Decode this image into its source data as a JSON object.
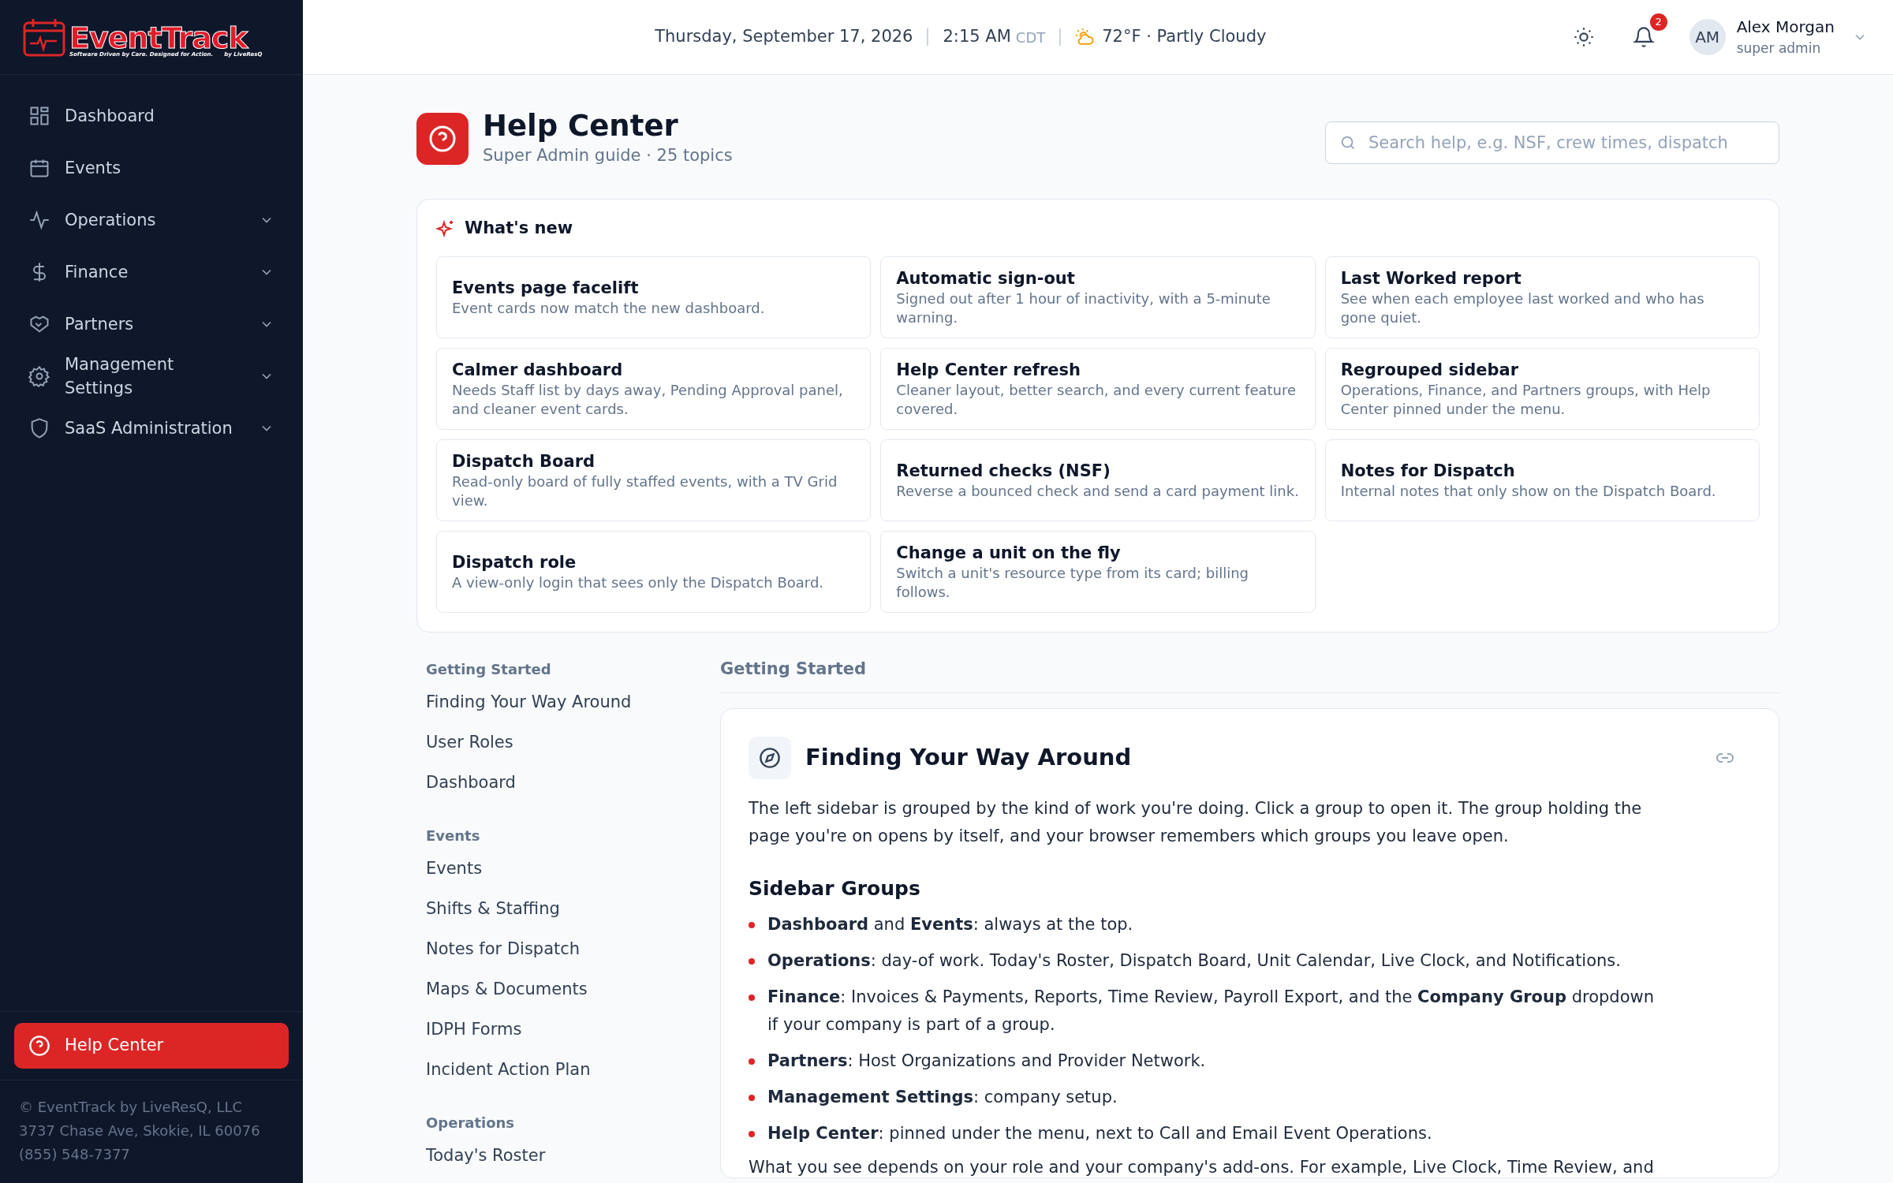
{
  "brand": {
    "name": "EventTrack",
    "tagline": "Software Driven by Care. Designed for Action.",
    "byline": "by LiveResQ"
  },
  "sidebar": {
    "items": [
      {
        "label": "Dashboard",
        "kind": "link"
      },
      {
        "label": "Events",
        "kind": "link"
      },
      {
        "label": "Operations",
        "kind": "group",
        "expanded": false
      },
      {
        "label": "Finance",
        "kind": "group",
        "expanded": false
      },
      {
        "label": "Partners",
        "kind": "group",
        "expanded": false
      },
      {
        "label": "Management Settings",
        "kind": "group",
        "expanded": false
      },
      {
        "label": "SaaS Administration",
        "kind": "group",
        "expanded": false
      }
    ],
    "help_button": "Help Center",
    "footer": [
      "© EventTrack by LiveResQ, LLC",
      "3737 Chase Ave, Skokie, IL 60076",
      "(855) 548-7377"
    ]
  },
  "header": {
    "date": "Thursday, September 17, 2026",
    "time": "2:15 AM",
    "timezone": "CDT",
    "weather": "72°F · Partly Cloudy",
    "notification_count": "2",
    "user": {
      "initials": "AM",
      "name": "Alex Morgan",
      "role": "super admin"
    }
  },
  "help": {
    "title": "Help Center",
    "subtitle": "Super Admin guide · 25 topics",
    "search_placeholder": "Search help, e.g. NSF, crew times, dispatch"
  },
  "whats_new": {
    "title": "What's new",
    "items": [
      {
        "title": "Events page facelift",
        "description": "Event cards now match the new dashboard."
      },
      {
        "title": "Automatic sign-out",
        "description": "Signed out after 1 hour of inactivity, with a 5-minute warning."
      },
      {
        "title": "Last Worked report",
        "description": "See when each employee last worked and who has gone quiet."
      },
      {
        "title": "Calmer dashboard",
        "description": "Needs Staff list by days away, Pending Approval panel, and cleaner event cards."
      },
      {
        "title": "Help Center refresh",
        "description": "Cleaner layout, better search, and every current feature covered."
      },
      {
        "title": "Regrouped sidebar",
        "description": "Operations, Finance, and Partners groups, with Help Center pinned under the menu."
      },
      {
        "title": "Dispatch Board",
        "description": "Read-only board of fully staffed events, with a TV Grid view."
      },
      {
        "title": "Returned checks (NSF)",
        "description": "Reverse a bounced check and send a card payment link."
      },
      {
        "title": "Notes for Dispatch",
        "description": "Internal notes that only show on the Dispatch Board."
      },
      {
        "title": "Dispatch role",
        "description": "A view-only login that sees only the Dispatch Board."
      },
      {
        "title": "Change a unit on the fly",
        "description": "Switch a unit's resource type from its card; billing follows."
      }
    ]
  },
  "toc": [
    {
      "heading": "Getting Started",
      "items": [
        "Finding Your Way Around",
        "User Roles",
        "Dashboard"
      ]
    },
    {
      "heading": "Events",
      "items": [
        "Events",
        "Shifts & Staffing",
        "Notes for Dispatch",
        "Maps & Documents",
        "IDPH Forms",
        "Incident Action Plan"
      ]
    },
    {
      "heading": "Operations",
      "items": [
        "Today's Roster"
      ]
    }
  ],
  "article": {
    "section": "Getting Started",
    "title": "Finding Your Way Around",
    "intro": "The left sidebar is grouped by the kind of work you're doing. Click a group to open it. The group holding the page you're on opens by itself, and your browser remembers which groups you leave open.",
    "subheading": "Sidebar Groups",
    "bullets": [
      "**Dashboard** and **Events**: always at the top.",
      "**Operations**: day-of work. Today's Roster, Dispatch Board, Unit Calendar, Live Clock, and Notifications.",
      "**Finance**: Invoices & Payments, Reports, Time Review, Payroll Export, and the **Company Group** dropdown if your company is part of a group.",
      "**Partners**: Host Organizations and Provider Network.",
      "**Management Settings**: company setup.",
      "**Help Center**: pinned under the menu, next to Call and Email Event Operations."
    ],
    "outro": "What you see depends on your role and your company's add-ons. For example, Live Clock, Time Review, and"
  }
}
